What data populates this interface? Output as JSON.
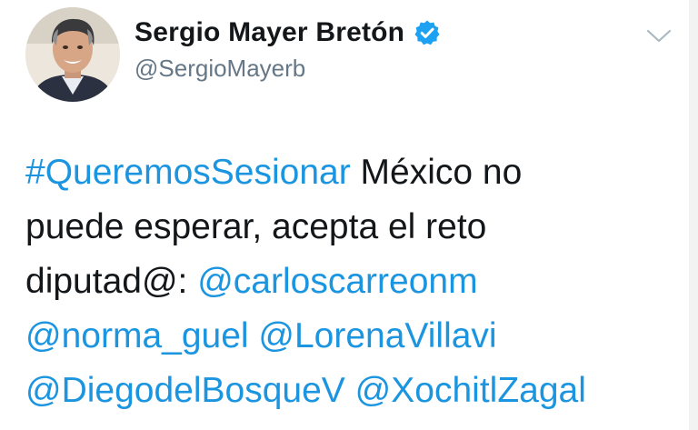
{
  "header": {
    "display_name": "Sergio Mayer Bretón",
    "handle": "@SergioMayerb",
    "verified_icon": "verified-badge-icon",
    "menu_icon": "chevron-down-icon"
  },
  "tweet": {
    "lines": [
      [
        {
          "text": "#QueremosSesionar",
          "type": "hashtag"
        },
        {
          "text": " México no",
          "type": "text"
        }
      ],
      [
        {
          "text": "puede esperar, acepta el reto",
          "type": "text"
        }
      ],
      [
        {
          "text": "diputad@:  ",
          "type": "text"
        },
        {
          "text": "@carloscarreonm",
          "type": "mention"
        }
      ],
      [
        {
          "text": "@norma_guel",
          "type": "mention"
        },
        {
          "text": " ",
          "type": "text"
        },
        {
          "text": "@LorenaVillavi",
          "type": "mention"
        }
      ],
      [
        {
          "text": "@DiegodelBosqueV",
          "type": "mention"
        },
        {
          "text": " ",
          "type": "text"
        },
        {
          "text": "@XochitlZagal",
          "type": "mention"
        }
      ]
    ]
  },
  "colors": {
    "link": "#1b95e0",
    "text": "#14171a",
    "handle": "#657786",
    "verified": "#1da1f2",
    "chevron": "#aab8c2"
  }
}
